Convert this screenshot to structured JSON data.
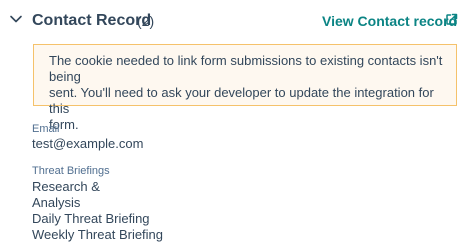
{
  "header": {
    "title": "Contact Record",
    "count": "(2)",
    "view_link": "View Contact record",
    "link_color": "#0b8484"
  },
  "alert": {
    "lines": [
      "The cookie needed to link form submissions to existing contacts isn't being",
      "sent. You'll need to ask your developer to update the integration for this",
      "form."
    ],
    "background": "#fef8f0",
    "border": "#f5c26b"
  },
  "fields": {
    "email": {
      "label": "Email",
      "value": "test@example.com"
    },
    "threat_briefings": {
      "label": "Threat Briefings",
      "values": [
        "Research &",
        "Analysis",
        "Daily Threat Briefing",
        "Weekly Threat Briefing"
      ]
    }
  },
  "icons": {
    "collapse": "chevron-down-icon",
    "external": "external-link-icon"
  }
}
